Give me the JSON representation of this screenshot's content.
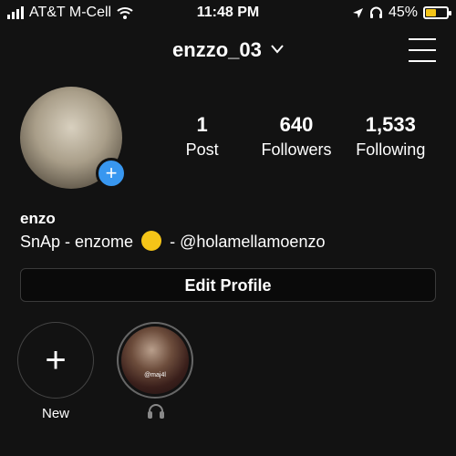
{
  "status_bar": {
    "carrier": "AT&T M-Cell",
    "time": "11:48 PM",
    "battery_pct": "45%",
    "battery_level": 0.45
  },
  "header": {
    "username": "enzzo_03",
    "dropdown_glyph": "⌄"
  },
  "stats": [
    {
      "value": "1",
      "label": "Post"
    },
    {
      "value": "640",
      "label": "Followers"
    },
    {
      "value": "1,533",
      "label": "Following"
    }
  ],
  "profile": {
    "name": "enzo",
    "bio_before": "SnAp - enzome",
    "bio_after": "- @holamellamoenzo",
    "add_glyph": "+"
  },
  "edit_button": {
    "label": "Edit Profile"
  },
  "highlights": {
    "new": {
      "glyph": "+",
      "label": "New"
    },
    "story": {
      "image_tag": "@maj4l"
    }
  },
  "colors": {
    "accent_blue": "#3897f0",
    "background": "#121212",
    "battery_charging": "#f5c518"
  }
}
